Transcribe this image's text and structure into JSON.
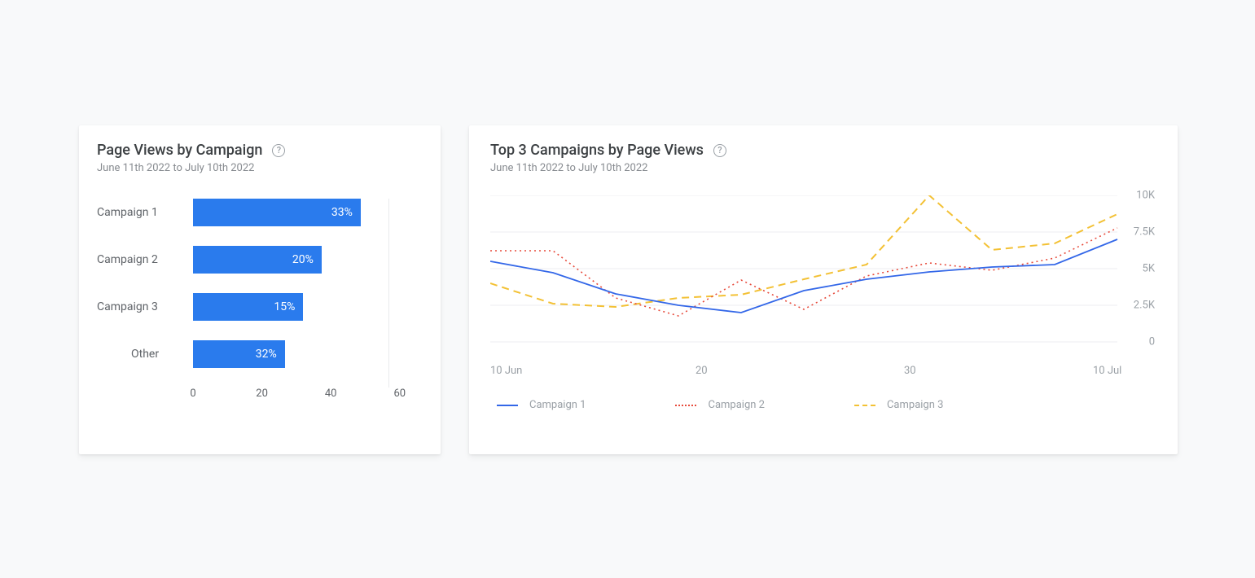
{
  "left": {
    "title": "Page Views by Campaign",
    "subtitle": "June 11th 2022 to July 10th 2022"
  },
  "right": {
    "title": "Top 3 Campaigns by Page Views",
    "subtitle": "June 11th 2022 to July 10th 2022"
  },
  "bar_labels": {
    "c1": "Campaign 1",
    "c2": "Campaign 2",
    "c3": "Campaign 3",
    "other": "Other"
  },
  "bar_values": {
    "c1": "33%",
    "c2": "20%",
    "c3": "15%",
    "other": "32%"
  },
  "bar_ticks": {
    "t0": "0",
    "t20": "20",
    "t40": "40",
    "t60": "60"
  },
  "y_ticks": {
    "t10k": "10K",
    "t7_5k": "7.5K",
    "t5k": "5K",
    "t2_5k": "2.5K",
    "t0": "0"
  },
  "x_ticks": {
    "j10": "10 Jun",
    "d20": "20",
    "d30": "30",
    "jul10": "10 Jul"
  },
  "legend": {
    "c1": "Campaign 1",
    "c2": "Campaign 2",
    "c3": "Campaign 3"
  },
  "colors": {
    "c1": "#3367e8",
    "c2": "#e74b3c",
    "c3": "#f3c135",
    "bar": "#2a7bed"
  },
  "chart_data": [
    {
      "type": "bar",
      "orientation": "horizontal",
      "title": "Page Views by Campaign",
      "subtitle": "June 11th 2022 to July 10th 2022",
      "xlabel": "",
      "ylabel": "",
      "xlim": [
        0,
        60
      ],
      "categories": [
        "Campaign 1",
        "Campaign 2",
        "Campaign 3",
        "Other"
      ],
      "values": [
        33,
        20,
        15,
        32
      ],
      "value_labels": [
        "33%",
        "20%",
        "15%",
        "32%"
      ],
      "x_ticks": [
        0,
        20,
        40,
        60
      ]
    },
    {
      "type": "line",
      "title": "Top 3 Campaigns by Page Views",
      "subtitle": "June 11th 2022 to July 10th 2022",
      "xlabel": "",
      "ylabel": "",
      "ylim": [
        0,
        10000
      ],
      "y_ticks": [
        0,
        2500,
        5000,
        7500,
        10000
      ],
      "x_tick_labels": [
        "10 Jun",
        "20",
        "30",
        "10 Jul"
      ],
      "x": [
        "Jun 10",
        "Jun 13",
        "Jun 16",
        "Jun 19",
        "Jun 22",
        "Jun 25",
        "Jun 28",
        "Jul 1",
        "Jul 4",
        "Jul 7",
        "Jul 10"
      ],
      "series": [
        {
          "name": "Campaign 1",
          "color": "#3367e8",
          "style": "solid",
          "values": [
            5500,
            4700,
            3300,
            2500,
            2000,
            3500,
            4300,
            4800,
            5100,
            5300,
            7000
          ]
        },
        {
          "name": "Campaign 2",
          "color": "#e74b3c",
          "style": "dotted",
          "values": [
            6200,
            6200,
            3000,
            1800,
            4200,
            2200,
            4500,
            5400,
            4900,
            5700,
            7800
          ]
        },
        {
          "name": "Campaign 3",
          "color": "#f3c135",
          "style": "dashed",
          "values": [
            4000,
            2600,
            2400,
            3000,
            3200,
            4300,
            5300,
            10000,
            6300,
            6700,
            8700
          ]
        }
      ],
      "legend_position": "bottom"
    }
  ]
}
